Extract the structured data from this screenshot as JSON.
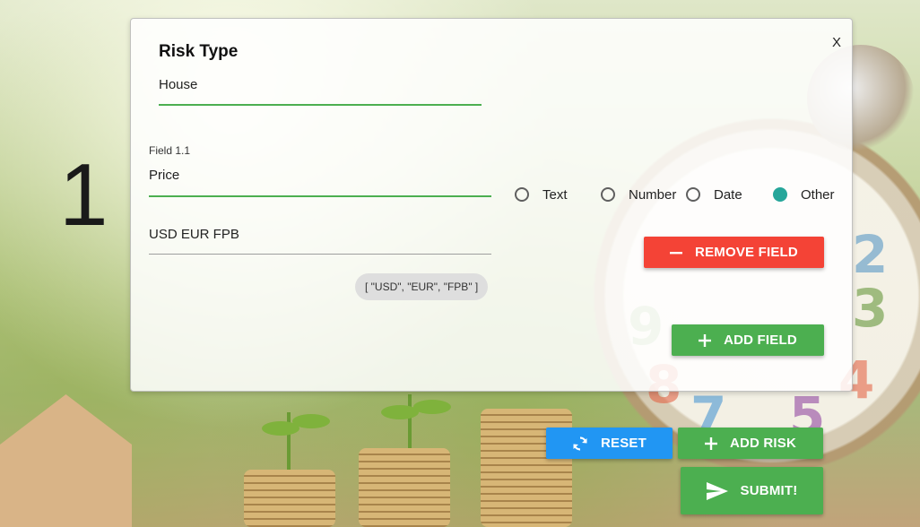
{
  "risk_index": "1",
  "card": {
    "close_label": "X",
    "title": "Risk Type",
    "risk_type_value": "House"
  },
  "field": {
    "label": "Field 1.1",
    "name_value": "Price",
    "options_value": "USD EUR FPB",
    "options_chip": "[ \"USD\", \"EUR\", \"FPB\" ]",
    "type_options": [
      {
        "label": "Text",
        "checked": false
      },
      {
        "label": "Number",
        "checked": false
      },
      {
        "label": "Date",
        "checked": false
      },
      {
        "label": "Other",
        "checked": true
      }
    ]
  },
  "buttons": {
    "remove_field": "REMOVE FIELD",
    "add_field": "ADD FIELD",
    "reset": "RESET",
    "add_risk": "ADD RISK",
    "submit": "SUBMIT!"
  },
  "colors": {
    "accent_green": "#4caf50",
    "danger_red": "#f44336",
    "primary_blue": "#2196f3",
    "radio_teal": "#26a69a"
  },
  "icons": {
    "remove_field": "minus-icon",
    "add_field": "plus-icon",
    "reset": "refresh-icon",
    "add_risk": "plus-icon",
    "submit": "send-icon"
  }
}
